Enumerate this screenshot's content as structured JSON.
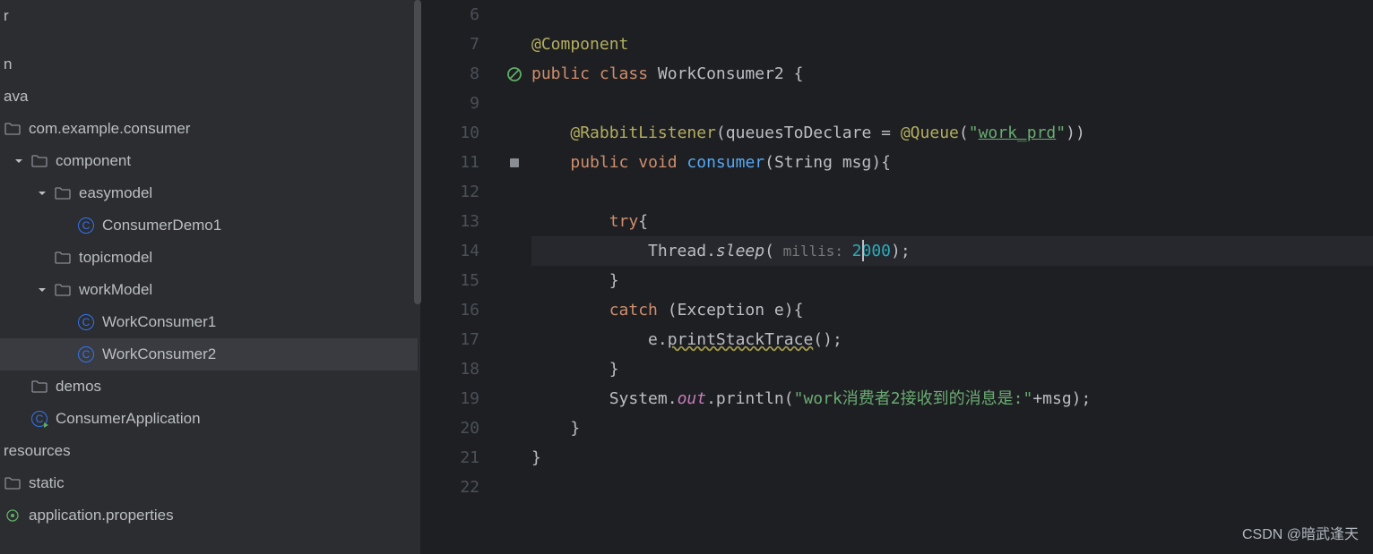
{
  "sidebar": {
    "items": [
      {
        "label": "r",
        "indent": 0,
        "type": "text"
      },
      {
        "label": "",
        "indent": 0,
        "type": "blank"
      },
      {
        "label": "n",
        "indent": 0,
        "type": "text"
      },
      {
        "label": "ava",
        "indent": 0,
        "type": "text"
      },
      {
        "label": "com.example.consumer",
        "indent": 0,
        "type": "package",
        "icon": "folder"
      },
      {
        "label": "component",
        "indent": 8,
        "type": "package",
        "icon": "folder",
        "arrow": "down"
      },
      {
        "label": "easymodel",
        "indent": 34,
        "type": "package",
        "icon": "folder",
        "arrow": "down"
      },
      {
        "label": "ConsumerDemo1",
        "indent": 82,
        "type": "class"
      },
      {
        "label": "topicmodel",
        "indent": 56,
        "type": "package",
        "icon": "folder"
      },
      {
        "label": "workModel",
        "indent": 34,
        "type": "package",
        "icon": "folder",
        "arrow": "down"
      },
      {
        "label": "WorkConsumer1",
        "indent": 82,
        "type": "class"
      },
      {
        "label": "WorkConsumer2",
        "indent": 82,
        "type": "class",
        "selected": true
      },
      {
        "label": "demos",
        "indent": 30,
        "type": "package",
        "icon": "folder"
      },
      {
        "label": "ConsumerApplication",
        "indent": 30,
        "type": "class-run"
      },
      {
        "label": "resources",
        "indent": 0,
        "type": "text"
      },
      {
        "label": "static",
        "indent": 0,
        "type": "package",
        "icon": "folder"
      },
      {
        "label": "application.properties",
        "indent": 0,
        "type": "file-prop"
      }
    ]
  },
  "editor": {
    "lines": [
      {
        "num": "6",
        "tokens": []
      },
      {
        "num": "7",
        "tokens": [
          {
            "t": "@Component",
            "c": "annotation",
            "indent": 0
          }
        ]
      },
      {
        "num": "8",
        "gi": "no-entry",
        "tokens": [
          {
            "t": "public",
            "c": "kw",
            "indent": 0
          },
          {
            "t": " class ",
            "c": "kw"
          },
          {
            "t": "WorkConsumer2 {",
            "c": "class-name"
          }
        ]
      },
      {
        "num": "9",
        "tokens": []
      },
      {
        "num": "10",
        "tokens": [
          {
            "t": "@RabbitListener",
            "c": "annotation",
            "indent": 4
          },
          {
            "t": "(",
            "c": ""
          },
          {
            "t": "queuesToDeclare = ",
            "c": ""
          },
          {
            "t": "@Queue",
            "c": "annotation"
          },
          {
            "t": "(",
            "c": ""
          },
          {
            "t": "\"",
            "c": "string"
          },
          {
            "t": "work_prd",
            "c": "string string-underline"
          },
          {
            "t": "\"",
            "c": "string"
          },
          {
            "t": "))",
            "c": ""
          }
        ]
      },
      {
        "num": "11",
        "gi": "impl",
        "tokens": [
          {
            "t": "public",
            "c": "kw",
            "indent": 4
          },
          {
            "t": " void ",
            "c": "kw"
          },
          {
            "t": "consumer",
            "c": "method"
          },
          {
            "t": "(String msg){",
            "c": ""
          }
        ]
      },
      {
        "num": "12",
        "tokens": []
      },
      {
        "num": "13",
        "tokens": [
          {
            "t": "try",
            "c": "kw",
            "indent": 8
          },
          {
            "t": "{",
            "c": ""
          }
        ]
      },
      {
        "num": "14",
        "current": true,
        "tokens": [
          {
            "t": "Thread.",
            "c": "",
            "indent": 12
          },
          {
            "t": "sleep",
            "c": "italic"
          },
          {
            "t": "(",
            "c": ""
          },
          {
            "t": " millis: ",
            "c": "param-hint"
          },
          {
            "t": "2",
            "c": "number"
          },
          {
            "t": "000",
            "c": "number",
            "cursor": true
          },
          {
            "t": ");",
            "c": ""
          }
        ]
      },
      {
        "num": "15",
        "tokens": [
          {
            "t": "}",
            "c": "",
            "indent": 8
          }
        ]
      },
      {
        "num": "16",
        "tokens": [
          {
            "t": "catch",
            "c": "kw",
            "indent": 8
          },
          {
            "t": " (Exception e){",
            "c": ""
          }
        ]
      },
      {
        "num": "17",
        "tokens": [
          {
            "t": "e.",
            "c": "",
            "indent": 12
          },
          {
            "t": "printStackTrace",
            "c": "warn-underline"
          },
          {
            "t": "();",
            "c": ""
          }
        ]
      },
      {
        "num": "18",
        "tokens": [
          {
            "t": "}",
            "c": "",
            "indent": 8
          }
        ]
      },
      {
        "num": "19",
        "tokens": [
          {
            "t": "System.",
            "c": "",
            "indent": 8
          },
          {
            "t": "out",
            "c": "field"
          },
          {
            "t": ".println(",
            "c": ""
          },
          {
            "t": "\"work消费者2接收到的消息是:\"",
            "c": "string"
          },
          {
            "t": "+msg);",
            "c": ""
          }
        ]
      },
      {
        "num": "20",
        "tokens": [
          {
            "t": "}",
            "c": "",
            "indent": 4
          }
        ]
      },
      {
        "num": "21",
        "tokens": [
          {
            "t": "}",
            "c": "",
            "indent": 0
          }
        ]
      },
      {
        "num": "22",
        "tokens": []
      }
    ]
  },
  "watermark": "CSDN @暗武逢天"
}
